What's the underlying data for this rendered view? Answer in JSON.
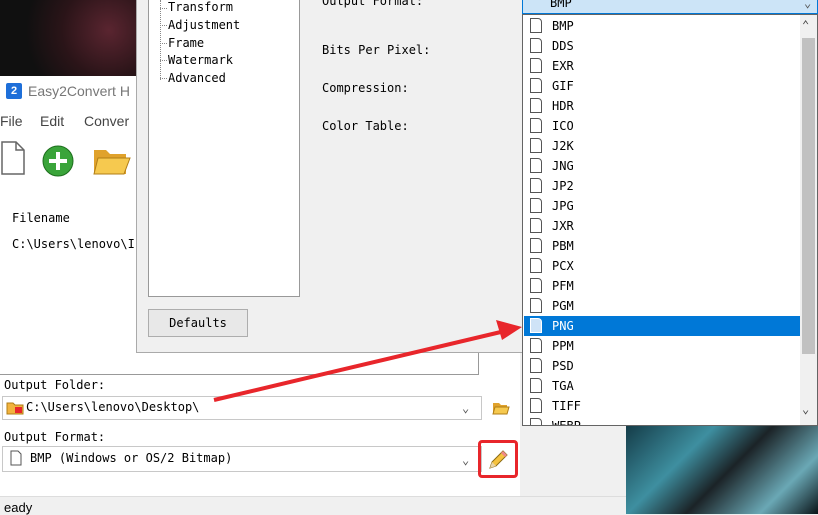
{
  "app": {
    "title": "Easy2Convert H",
    "icon_text": "2"
  },
  "menu": [
    "File",
    "Edit",
    "Conver"
  ],
  "toolbar": [
    "new-file-icon",
    "add-icon",
    "open-folder-icon"
  ],
  "file_list": {
    "header": "Filename",
    "rows": [
      "C:\\Users\\lenovo\\I"
    ]
  },
  "output_folder": {
    "label": "Output Folder:",
    "value": "C:\\Users\\lenovo\\Desktop\\"
  },
  "output_format": {
    "label": "Output Format:",
    "value": "BMP (Windows or OS/2 Bitmap)"
  },
  "status": {
    "text": "eady"
  },
  "dialog": {
    "tree": [
      "Transform",
      "Adjustment",
      "Frame",
      "Watermark",
      "Advanced"
    ],
    "labels": {
      "output_format": "Output Format:",
      "bits": "Bits Per Pixel:",
      "compression": "Compression:",
      "color_table": "Color Table:"
    },
    "defaults_button": "Defaults",
    "format_combo_value": "BMP"
  },
  "dropdown": {
    "items": [
      "BMP",
      "DDS",
      "EXR",
      "GIF",
      "HDR",
      "ICO",
      "J2K",
      "JNG",
      "JP2",
      "JPG",
      "JXR",
      "PBM",
      "PCX",
      "PFM",
      "PGM",
      "PNG",
      "PPM",
      "PSD",
      "TGA",
      "TIFF",
      "WEBP"
    ],
    "selected": "PNG"
  },
  "colors": {
    "selection": "#0078d7",
    "annotation": "#e8262b",
    "folder": "#f2b33d"
  }
}
